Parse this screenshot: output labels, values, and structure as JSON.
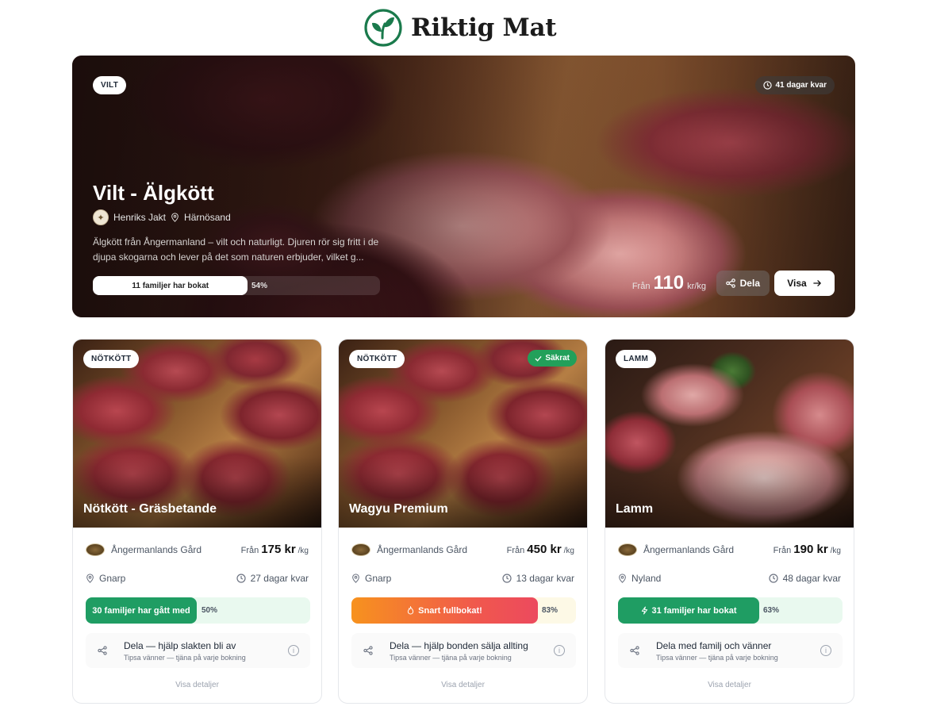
{
  "brand": {
    "name": "Riktig Mat",
    "accent": "#1a7a4c"
  },
  "hero": {
    "category": "VILT",
    "days_left": "41 dagar kvar",
    "title": "Vilt - Älgkött",
    "producer": "Henriks Jakt",
    "location": "Härnösand",
    "description": "Älgkött från Ångermanland – vilt och naturligt. Djuren rör sig fritt i de djupa skogarna och lever på det som naturen erbjuder, vilket g...",
    "booked_label": "11 familjer har bokat",
    "percent": "54%",
    "price_from": "Från",
    "price": "110",
    "price_unit": "kr/kg",
    "share_label": "Dela",
    "view_label": "Visa"
  },
  "cards": [
    {
      "category": "NÖTKÖTT",
      "title": "Nötkött - Gräsbetande",
      "farm": "Ångermanlands Gård",
      "price_from": "Från",
      "price": "175 kr",
      "price_unit": "/kg",
      "location": "Gnarp",
      "days_left": "27 dagar kvar",
      "bar_label": "30 familjer har gått med",
      "percent": "50%",
      "share_title": "Dela — hjälp slakten bli av",
      "share_sub": "Tipsa vänner — tjäna på varje bokning",
      "details": "Visa detaljer"
    },
    {
      "category": "NÖTKÖTT",
      "badge": "Säkrat",
      "title": "Wagyu Premium",
      "farm": "Ångermanlands Gård",
      "price_from": "Från",
      "price": "450 kr",
      "price_unit": "/kg",
      "location": "Gnarp",
      "days_left": "13 dagar kvar",
      "bar_label": "Snart fullbokat!",
      "percent": "83%",
      "share_title": "Dela — hjälp bonden sälja allting",
      "share_sub": "Tipsa vänner — tjäna på varje bokning",
      "details": "Visa detaljer"
    },
    {
      "category": "LAMM",
      "title": "Lamm",
      "farm": "Ångermanlands Gård",
      "price_from": "Från",
      "price": "190 kr",
      "price_unit": "/kg",
      "location": "Nyland",
      "days_left": "48 dagar kvar",
      "bar_label": "31 familjer har bokat",
      "percent": "63%",
      "share_title": "Dela med familj och vänner",
      "share_sub": "Tipsa vänner — tjäna på varje bokning",
      "details": "Visa detaljer"
    }
  ],
  "icons": [
    "leaf-logo-icon",
    "clock-icon",
    "pin-icon",
    "share-icon",
    "arrow-right-icon",
    "check-icon",
    "fire-icon",
    "bolt-icon",
    "info-icon"
  ]
}
